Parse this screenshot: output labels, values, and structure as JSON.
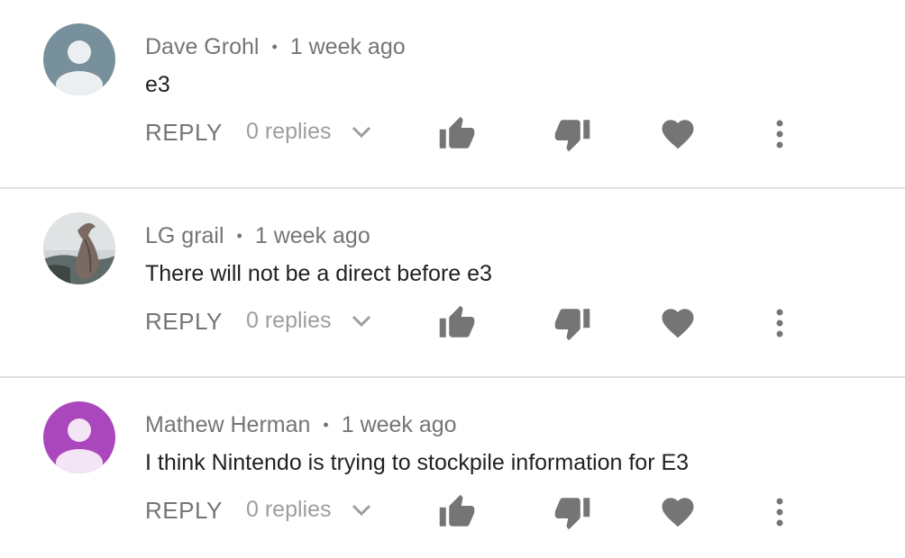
{
  "comments": [
    {
      "author": "Dave Grohl",
      "separator": "•",
      "time": "1 week ago",
      "text": "e3",
      "reply_label": "REPLY",
      "replies_label": "0 replies",
      "avatar_color": "#78909c"
    },
    {
      "author": "LG grail",
      "separator": "•",
      "time": "1 week ago",
      "text": "There will not be a direct before e3",
      "reply_label": "REPLY",
      "replies_label": "0 replies",
      "avatar_color": "#9e9e9e"
    },
    {
      "author": "Mathew Herman",
      "separator": "•",
      "time": "1 week ago",
      "text": "I think Nintendo is trying to stockpile information for E3",
      "reply_label": "REPLY",
      "replies_label": "0 replies",
      "avatar_color": "#ab47bc"
    }
  ],
  "colors": {
    "icon": "#757575",
    "secondary_text": "#757575",
    "primary_text": "#212121",
    "divider": "#e0e0e0"
  },
  "icons": [
    "thumbs-up-icon",
    "thumbs-down-icon",
    "heart-icon",
    "more-vert-icon",
    "chevron-down-icon",
    "person-icon"
  ]
}
